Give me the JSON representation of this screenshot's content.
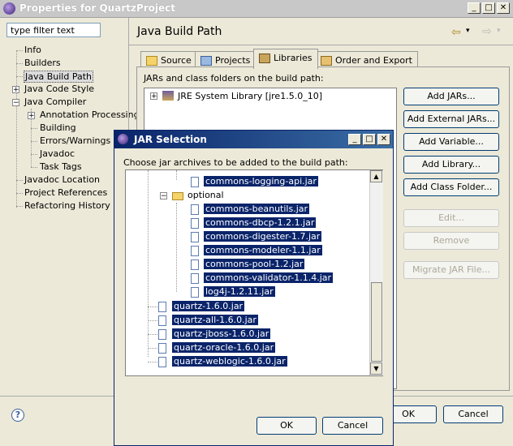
{
  "window": {
    "title": "Properties for QuartzProject"
  },
  "filter": {
    "placeholder": "type filter text"
  },
  "nav": {
    "items": [
      "Info",
      "Builders",
      "Java Build Path",
      "Java Code Style",
      "Java Compiler",
      "Annotation Processing",
      "Building",
      "Errors/Warnings",
      "Javadoc",
      "Task Tags",
      "Javadoc Location",
      "Project References",
      "Refactoring History"
    ],
    "selected": "Java Build Path"
  },
  "pane": {
    "title": "Java Build Path",
    "tabs": [
      "Source",
      "Projects",
      "Libraries",
      "Order and Export"
    ],
    "active_tab": "Libraries",
    "section_label": "JARs and class folders on the build path:",
    "libraries": [
      "JRE System Library [jre1.5.0_10]"
    ],
    "buttons": [
      "Add JARs...",
      "Add External JARs...",
      "Add Variable...",
      "Add Library...",
      "Add Class Folder...",
      "Edit...",
      "Remove",
      "Migrate JAR File..."
    ]
  },
  "footer": {
    "ok": "OK",
    "cancel": "Cancel"
  },
  "dialog": {
    "title": "JAR Selection",
    "prompt": "Choose jar archives to be added to the build path:",
    "top_item": "commons-logging-api.jar",
    "folder": "optional",
    "optional_items": [
      "commons-beanutils.jar",
      "commons-dbcp-1.2.1.jar",
      "commons-digester-1.7.jar",
      "commons-modeler-1.1.jar",
      "commons-pool-1.2.jar",
      "commons-validator-1.1.4.jar",
      "log4j-1.2.11.jar"
    ],
    "root_items": [
      "quartz-1.6.0.jar",
      "quartz-all-1.6.0.jar",
      "quartz-jboss-1.6.0.jar",
      "quartz-oracle-1.6.0.jar",
      "quartz-weblogic-1.6.0.jar"
    ],
    "ok": "OK",
    "cancel": "Cancel"
  },
  "colors": {
    "selection": "#0a246a",
    "dialog_title": "#0a246a",
    "background": "#ece9d8"
  }
}
